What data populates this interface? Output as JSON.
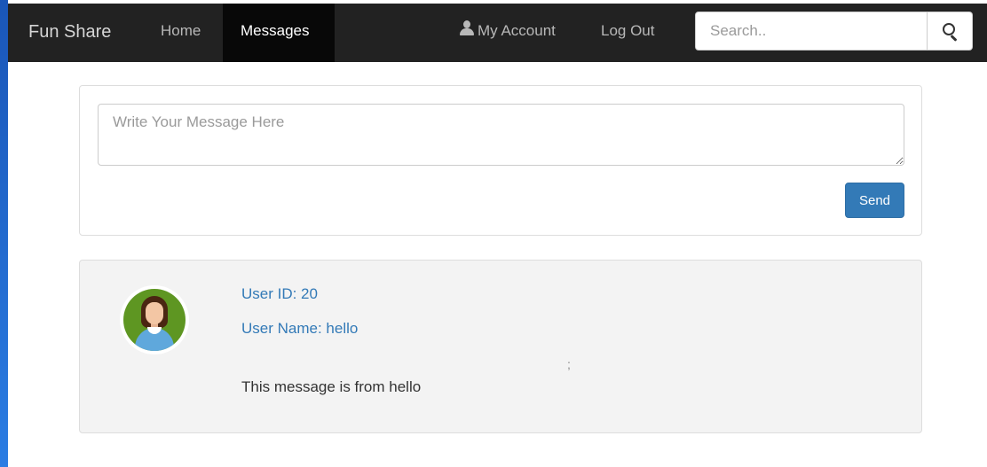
{
  "navbar": {
    "brand": "Fun Share",
    "links": [
      {
        "label": "Home",
        "active": false
      },
      {
        "label": "Messages",
        "active": true
      }
    ],
    "account_label": "My Account",
    "logout_label": "Log Out",
    "account_icon": "user-icon",
    "search": {
      "placeholder": "Search..",
      "value": "",
      "button_icon": "search-icon"
    }
  },
  "compose": {
    "placeholder": "Write Your Message Here",
    "value": "",
    "send_label": "Send"
  },
  "messages": [
    {
      "avatar_icon": "avatar-icon",
      "user_id": "User ID: 20",
      "user_name": "User Name: hello",
      "stray_char": ";",
      "text": "This message is from hello"
    }
  ],
  "colors": {
    "navbar_bg": "#222222",
    "navbar_active_bg": "#080808",
    "link_blue": "#337ab7",
    "send_button": "#337ab7",
    "message_panel_bg": "#f3f3f3"
  }
}
